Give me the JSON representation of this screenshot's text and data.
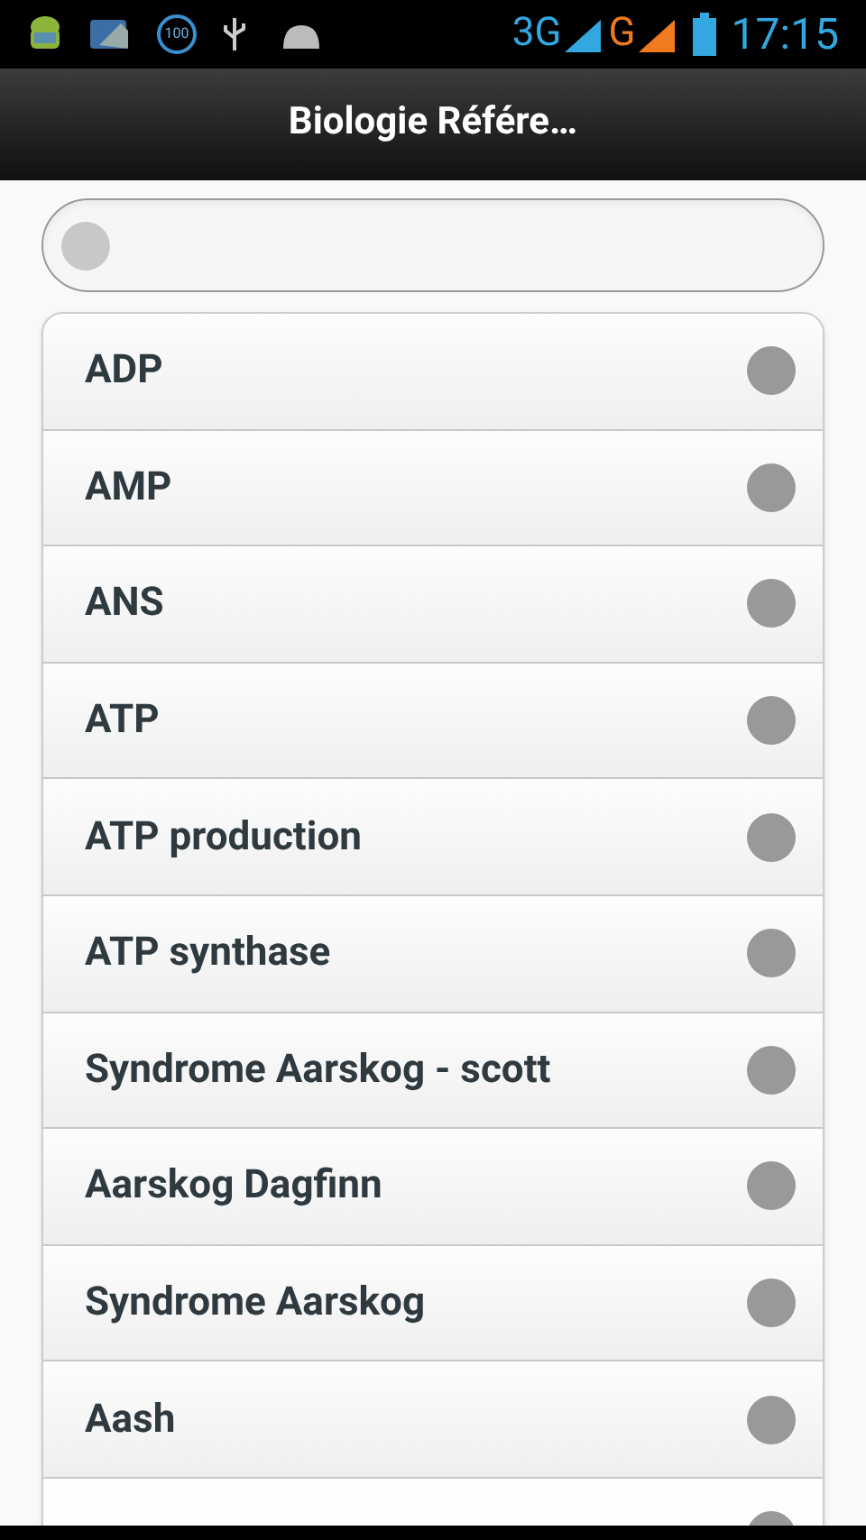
{
  "status_bar": {
    "badge": "100",
    "network_3g": "3G",
    "network_g": "G",
    "time": "17:15"
  },
  "header": {
    "title": "Biologie Référe…"
  },
  "items": [
    {
      "label": "ADP"
    },
    {
      "label": "AMP"
    },
    {
      "label": "ANS"
    },
    {
      "label": "ATP"
    },
    {
      "label": "ATP production"
    },
    {
      "label": "ATP synthase"
    },
    {
      "label": "Syndrome Aarskog - scott"
    },
    {
      "label": "Aarskog Dagfinn"
    },
    {
      "label": "Syndrome Aarskog"
    },
    {
      "label": "Aash"
    }
  ]
}
